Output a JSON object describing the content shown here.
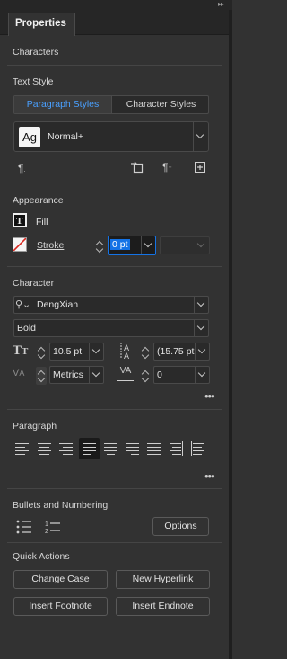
{
  "panel": {
    "tab_title": "Properties",
    "collapse_glyph": "▸▸"
  },
  "characters_section": {
    "title": "Characters"
  },
  "text_style": {
    "title": "Text Style",
    "paragraph_styles_tab": "Paragraph Styles",
    "character_styles_tab": "Character Styles",
    "active_tab": "Paragraph Styles",
    "style_preview": "Ag",
    "style_name": "Normal+"
  },
  "appearance": {
    "title": "Appearance",
    "fill_label": "Fill",
    "stroke_label": "Stroke",
    "stroke_weight": "0 pt"
  },
  "character": {
    "title": "Character",
    "font_family": "DengXian",
    "font_style": "Bold",
    "font_size": "10.5 pt",
    "leading": "(15.75 pt",
    "kerning": "Metrics",
    "tracking": "0"
  },
  "paragraph": {
    "title": "Paragraph",
    "alignments": [
      "align-left",
      "align-center",
      "align-right",
      "justify-left",
      "justify-center",
      "justify-right",
      "justify-all",
      "align-towards-spine",
      "align-away-from-spine"
    ],
    "selected_alignment": "justify-left"
  },
  "bullets": {
    "title": "Bullets and Numbering",
    "options_label": "Options"
  },
  "quick_actions": {
    "title": "Quick Actions",
    "change_case": "Change Case",
    "new_hyperlink": "New Hyperlink",
    "insert_footnote": "Insert Footnote",
    "insert_endnote": "Insert Endnote"
  },
  "colors": {
    "panel_bg": "#323232",
    "accent": "#4aa0ff",
    "focus": "#1473e6"
  }
}
